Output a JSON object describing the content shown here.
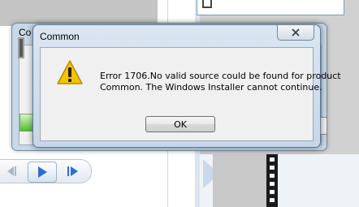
{
  "background_window": {
    "title": "Co"
  },
  "dialog": {
    "title": "Common",
    "close_icon": "close-icon",
    "message_line1": "Error 1706.No valid source could be found for product",
    "message_line2": "Common.  The Windows Installer cannot continue.",
    "ok_label": "OK",
    "icon": "warning-icon"
  },
  "media_controls": {
    "prev_icon": "previous-icon",
    "play_icon": "play-icon",
    "next_icon": "next-icon"
  },
  "colors": {
    "title_bar": "#c7d6e7",
    "client": "#f0f0f0",
    "warning_fill": "#f5c400",
    "play_blue": "#2d6fd1"
  }
}
